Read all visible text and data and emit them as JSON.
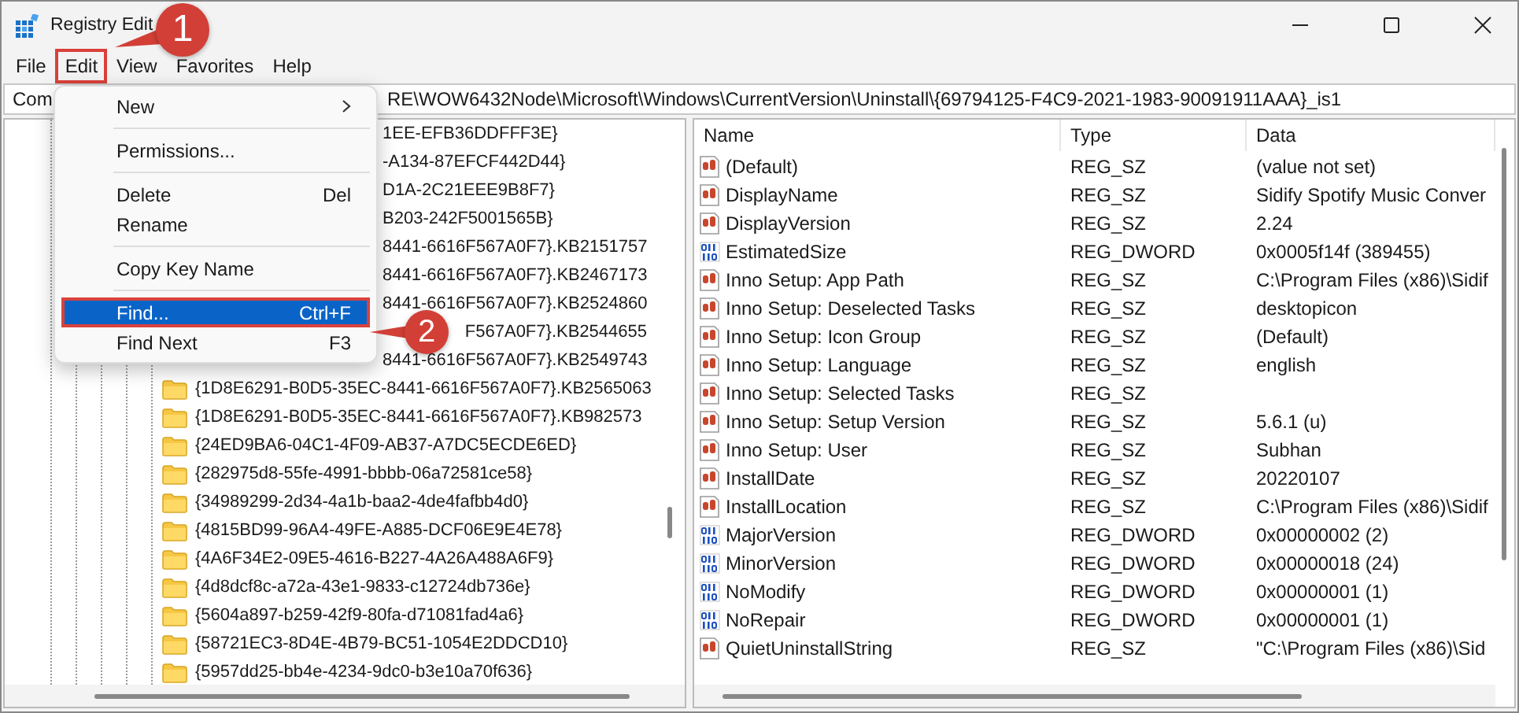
{
  "window": {
    "title": "Registry Edit"
  },
  "menu_bar": [
    {
      "label": "File",
      "outlined": false
    },
    {
      "label": "Edit",
      "outlined": true
    },
    {
      "label": "View",
      "outlined": false
    },
    {
      "label": "Favorites",
      "outlined": false
    },
    {
      "label": "Help",
      "outlined": false
    }
  ],
  "address": {
    "start": "Com",
    "end": "RE\\WOW6432Node\\Microsoft\\Windows\\CurrentVersion\\Uninstall\\{69794125-F4C9-2021-1983-90091911AAA}_is1"
  },
  "edit_menu": [
    {
      "kind": "item",
      "label": "New",
      "submenu": true,
      "selected": false,
      "outlined": false
    },
    {
      "kind": "separator"
    },
    {
      "kind": "item",
      "label": "Permissions...",
      "selected": false,
      "outlined": false
    },
    {
      "kind": "separator"
    },
    {
      "kind": "item",
      "label": "Delete",
      "shortcut": "Del",
      "selected": false,
      "outlined": false
    },
    {
      "kind": "item",
      "label": "Rename",
      "selected": false,
      "outlined": false
    },
    {
      "kind": "separator"
    },
    {
      "kind": "item",
      "label": "Copy Key Name",
      "selected": false,
      "outlined": false
    },
    {
      "kind": "separator"
    },
    {
      "kind": "item",
      "label": "Find...",
      "shortcut": "Ctrl+F",
      "selected": true,
      "outlined": true
    },
    {
      "kind": "item",
      "label": "Find Next",
      "shortcut": "F3",
      "selected": false,
      "outlined": false
    }
  ],
  "tree": [
    {
      "kind": "partial",
      "label": "1EE-EFB36DDFFF3E}"
    },
    {
      "kind": "partial",
      "label": "-A134-87EFCF442D44}"
    },
    {
      "kind": "partial",
      "label": "D1A-2C21EEE9B8F7}"
    },
    {
      "kind": "partial",
      "label": "B203-242F5001565B}"
    },
    {
      "kind": "partial",
      "label": "8441-6616F567A0F7}.KB2151757"
    },
    {
      "kind": "partial",
      "label": "8441-6616F567A0F7}.KB2467173"
    },
    {
      "kind": "partial",
      "label": "8441-6616F567A0F7}.KB2524860"
    },
    {
      "kind": "tail",
      "label": "F567A0F7}.KB2544655"
    },
    {
      "kind": "partial",
      "label": "8441-6616F567A0F7}.KB2549743"
    },
    {
      "kind": "folder",
      "label": "{1D8E6291-B0D5-35EC-8441-6616F567A0F7}.KB2565063"
    },
    {
      "kind": "folder",
      "label": "{1D8E6291-B0D5-35EC-8441-6616F567A0F7}.KB982573"
    },
    {
      "kind": "folder",
      "label": "{24ED9BA6-04C1-4F09-AB37-A7DC5ECDE6ED}"
    },
    {
      "kind": "folder",
      "label": "{282975d8-55fe-4991-bbbb-06a72581ce58}"
    },
    {
      "kind": "folder",
      "label": "{34989299-2d34-4a1b-baa2-4de4fafbb4d0}"
    },
    {
      "kind": "folder",
      "label": "{4815BD99-96A4-49FE-A885-DCF06E9E4E78}"
    },
    {
      "kind": "folder",
      "label": "{4A6F34E2-09E5-4616-B227-4A26A488A6F9}"
    },
    {
      "kind": "folder",
      "label": "{4d8dcf8c-a72a-43e1-9833-c12724db736e}"
    },
    {
      "kind": "folder",
      "label": "{5604a897-b259-42f9-80fa-d71081fad4a6}"
    },
    {
      "kind": "folder",
      "label": "{58721EC3-8D4E-4B79-BC51-1054E2DDCD10}"
    },
    {
      "kind": "folder",
      "label": "{5957dd25-bb4e-4234-9dc0-b3e10a70f636}"
    }
  ],
  "values": {
    "columns": [
      "Name",
      "Type",
      "Data"
    ],
    "rows": [
      {
        "kind": "string",
        "name": "(Default)",
        "type": "REG_SZ",
        "data": "(value not set)"
      },
      {
        "kind": "string",
        "name": "DisplayName",
        "type": "REG_SZ",
        "data": "Sidify Spotify Music Conver"
      },
      {
        "kind": "string",
        "name": "DisplayVersion",
        "type": "REG_SZ",
        "data": "2.24"
      },
      {
        "kind": "binary",
        "name": "EstimatedSize",
        "type": "REG_DWORD",
        "data": "0x0005f14f (389455)"
      },
      {
        "kind": "string",
        "name": "Inno Setup: App Path",
        "type": "REG_SZ",
        "data": "C:\\Program Files (x86)\\Sidif"
      },
      {
        "kind": "string",
        "name": "Inno Setup: Deselected Tasks",
        "type": "REG_SZ",
        "data": "desktopicon"
      },
      {
        "kind": "string",
        "name": "Inno Setup: Icon Group",
        "type": "REG_SZ",
        "data": "(Default)"
      },
      {
        "kind": "string",
        "name": "Inno Setup: Language",
        "type": "REG_SZ",
        "data": "english"
      },
      {
        "kind": "string",
        "name": "Inno Setup: Selected Tasks",
        "type": "REG_SZ"
      },
      {
        "kind": "string",
        "name": "Inno Setup: Setup Version",
        "type": "REG_SZ",
        "data": "5.6.1 (u)"
      },
      {
        "kind": "string",
        "name": "Inno Setup: User",
        "type": "REG_SZ",
        "data": "Subhan"
      },
      {
        "kind": "string",
        "name": "InstallDate",
        "type": "REG_SZ",
        "data": "20220107"
      },
      {
        "kind": "string",
        "name": "InstallLocation",
        "type": "REG_SZ",
        "data": "C:\\Program Files (x86)\\Sidif"
      },
      {
        "kind": "binary",
        "name": "MajorVersion",
        "type": "REG_DWORD",
        "data": "0x00000002 (2)"
      },
      {
        "kind": "binary",
        "name": "MinorVersion",
        "type": "REG_DWORD",
        "data": "0x00000018 (24)"
      },
      {
        "kind": "binary",
        "name": "NoModify",
        "type": "REG_DWORD",
        "data": "0x00000001 (1)"
      },
      {
        "kind": "binary",
        "name": "NoRepair",
        "type": "REG_DWORD",
        "data": "0x00000001 (1)"
      },
      {
        "kind": "string",
        "name": "QuietUninstallString",
        "type": "REG_SZ",
        "data": "\"C:\\Program Files (x86)\\Sid"
      }
    ]
  },
  "callouts": [
    {
      "label": "1"
    },
    {
      "label": "2"
    }
  ]
}
